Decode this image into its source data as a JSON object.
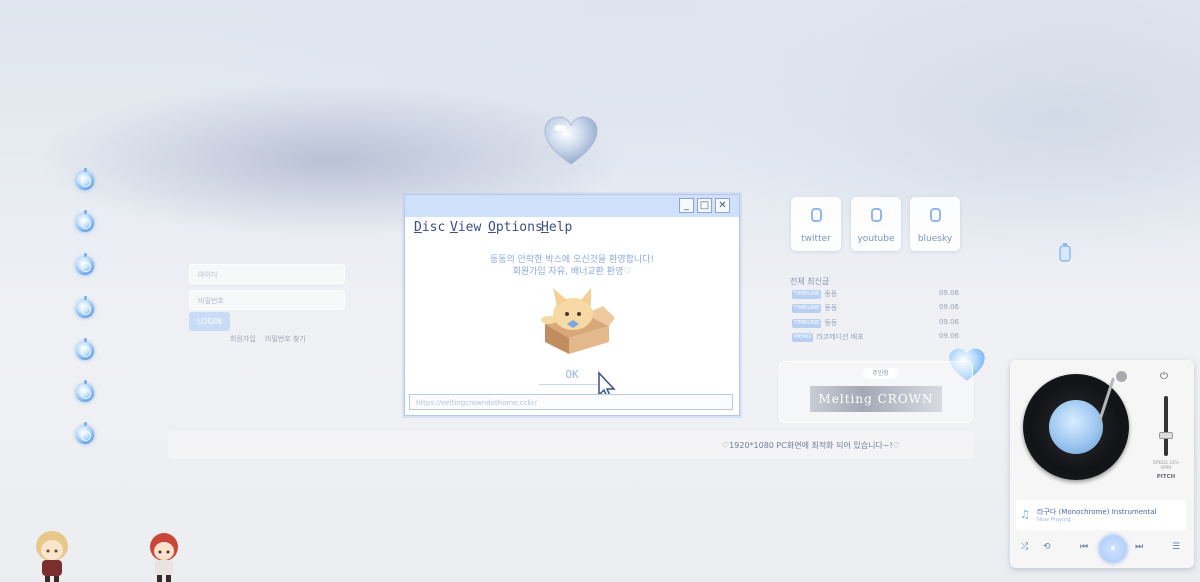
{
  "window": {
    "menu": [
      {
        "first": "D",
        "rest": "isc"
      },
      {
        "first": "V",
        "rest": "iew"
      },
      {
        "first": "O",
        "rest": "ptions"
      },
      {
        "first": "H",
        "rest": "elp"
      }
    ],
    "title_buttons": [
      "_",
      "□",
      "✕"
    ],
    "welcome_line1": "동동의 안락한 박스에 오신것을 환영합니다!",
    "welcome_line2": "회원가입 자유, 배너교환 환영♡",
    "ok_label": "OK",
    "url": "https://eeltingcrowndothome.cckr/"
  },
  "login": {
    "id_placeholder": "아이디",
    "pw_placeholder": "비밀번호",
    "login_label": "LOGIN",
    "signup_label": "회원가입",
    "find_label": "비밀번호 찾기"
  },
  "socials": [
    {
      "label": "twitter"
    },
    {
      "label": "youtube"
    },
    {
      "label": "bluesky"
    }
  ],
  "recent": {
    "title": "전체 최신글",
    "posts": [
      {
        "tag": "TIMELINE",
        "title": "동동",
        "date": "09.06"
      },
      {
        "tag": "TIMELINE",
        "title": "동동",
        "date": "09.06"
      },
      {
        "tag": "TIMELINE",
        "title": "동동",
        "date": "09.06"
      },
      {
        "tag": "MEMO",
        "title": "라코메디션 배포",
        "date": "09.06"
      }
    ]
  },
  "banner": {
    "label": "주민장",
    "image_text": "Melting CROWN"
  },
  "notice": "♡1920*1080 PC화면에 최적화 되어 있습니다~!♡",
  "player": {
    "speed_line1": "SPEED 33⅓",
    "speed_line2": "RPM",
    "pitch_label": "PITCH",
    "track_title": "라구다 (Monochrome) Instrumental",
    "track_status": "Now Playing",
    "power_icon": "⏻",
    "controls": [
      "⤮",
      "⟲",
      "⏮",
      "⏸",
      "⏭",
      "☰"
    ]
  },
  "icons": {
    "orb_count": 7,
    "heart": "glass-heart-icon"
  },
  "colors": {
    "accent": "#8fb8ea",
    "window_title": "#cfe0fb",
    "text_blue": "#3d4f83"
  }
}
